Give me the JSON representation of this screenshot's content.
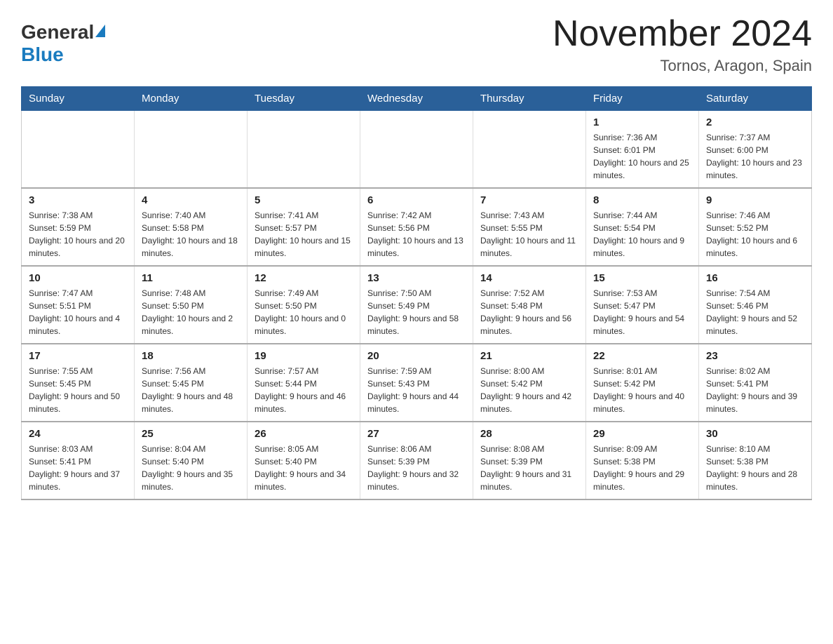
{
  "header": {
    "title": "November 2024",
    "location": "Tornos, Aragon, Spain",
    "logo_general": "General",
    "logo_blue": "Blue"
  },
  "days_of_week": [
    "Sunday",
    "Monday",
    "Tuesday",
    "Wednesday",
    "Thursday",
    "Friday",
    "Saturday"
  ],
  "weeks": [
    [
      {
        "day": "",
        "info": ""
      },
      {
        "day": "",
        "info": ""
      },
      {
        "day": "",
        "info": ""
      },
      {
        "day": "",
        "info": ""
      },
      {
        "day": "",
        "info": ""
      },
      {
        "day": "1",
        "info": "Sunrise: 7:36 AM\nSunset: 6:01 PM\nDaylight: 10 hours and 25 minutes."
      },
      {
        "day": "2",
        "info": "Sunrise: 7:37 AM\nSunset: 6:00 PM\nDaylight: 10 hours and 23 minutes."
      }
    ],
    [
      {
        "day": "3",
        "info": "Sunrise: 7:38 AM\nSunset: 5:59 PM\nDaylight: 10 hours and 20 minutes."
      },
      {
        "day": "4",
        "info": "Sunrise: 7:40 AM\nSunset: 5:58 PM\nDaylight: 10 hours and 18 minutes."
      },
      {
        "day": "5",
        "info": "Sunrise: 7:41 AM\nSunset: 5:57 PM\nDaylight: 10 hours and 15 minutes."
      },
      {
        "day": "6",
        "info": "Sunrise: 7:42 AM\nSunset: 5:56 PM\nDaylight: 10 hours and 13 minutes."
      },
      {
        "day": "7",
        "info": "Sunrise: 7:43 AM\nSunset: 5:55 PM\nDaylight: 10 hours and 11 minutes."
      },
      {
        "day": "8",
        "info": "Sunrise: 7:44 AM\nSunset: 5:54 PM\nDaylight: 10 hours and 9 minutes."
      },
      {
        "day": "9",
        "info": "Sunrise: 7:46 AM\nSunset: 5:52 PM\nDaylight: 10 hours and 6 minutes."
      }
    ],
    [
      {
        "day": "10",
        "info": "Sunrise: 7:47 AM\nSunset: 5:51 PM\nDaylight: 10 hours and 4 minutes."
      },
      {
        "day": "11",
        "info": "Sunrise: 7:48 AM\nSunset: 5:50 PM\nDaylight: 10 hours and 2 minutes."
      },
      {
        "day": "12",
        "info": "Sunrise: 7:49 AM\nSunset: 5:50 PM\nDaylight: 10 hours and 0 minutes."
      },
      {
        "day": "13",
        "info": "Sunrise: 7:50 AM\nSunset: 5:49 PM\nDaylight: 9 hours and 58 minutes."
      },
      {
        "day": "14",
        "info": "Sunrise: 7:52 AM\nSunset: 5:48 PM\nDaylight: 9 hours and 56 minutes."
      },
      {
        "day": "15",
        "info": "Sunrise: 7:53 AM\nSunset: 5:47 PM\nDaylight: 9 hours and 54 minutes."
      },
      {
        "day": "16",
        "info": "Sunrise: 7:54 AM\nSunset: 5:46 PM\nDaylight: 9 hours and 52 minutes."
      }
    ],
    [
      {
        "day": "17",
        "info": "Sunrise: 7:55 AM\nSunset: 5:45 PM\nDaylight: 9 hours and 50 minutes."
      },
      {
        "day": "18",
        "info": "Sunrise: 7:56 AM\nSunset: 5:45 PM\nDaylight: 9 hours and 48 minutes."
      },
      {
        "day": "19",
        "info": "Sunrise: 7:57 AM\nSunset: 5:44 PM\nDaylight: 9 hours and 46 minutes."
      },
      {
        "day": "20",
        "info": "Sunrise: 7:59 AM\nSunset: 5:43 PM\nDaylight: 9 hours and 44 minutes."
      },
      {
        "day": "21",
        "info": "Sunrise: 8:00 AM\nSunset: 5:42 PM\nDaylight: 9 hours and 42 minutes."
      },
      {
        "day": "22",
        "info": "Sunrise: 8:01 AM\nSunset: 5:42 PM\nDaylight: 9 hours and 40 minutes."
      },
      {
        "day": "23",
        "info": "Sunrise: 8:02 AM\nSunset: 5:41 PM\nDaylight: 9 hours and 39 minutes."
      }
    ],
    [
      {
        "day": "24",
        "info": "Sunrise: 8:03 AM\nSunset: 5:41 PM\nDaylight: 9 hours and 37 minutes."
      },
      {
        "day": "25",
        "info": "Sunrise: 8:04 AM\nSunset: 5:40 PM\nDaylight: 9 hours and 35 minutes."
      },
      {
        "day": "26",
        "info": "Sunrise: 8:05 AM\nSunset: 5:40 PM\nDaylight: 9 hours and 34 minutes."
      },
      {
        "day": "27",
        "info": "Sunrise: 8:06 AM\nSunset: 5:39 PM\nDaylight: 9 hours and 32 minutes."
      },
      {
        "day": "28",
        "info": "Sunrise: 8:08 AM\nSunset: 5:39 PM\nDaylight: 9 hours and 31 minutes."
      },
      {
        "day": "29",
        "info": "Sunrise: 8:09 AM\nSunset: 5:38 PM\nDaylight: 9 hours and 29 minutes."
      },
      {
        "day": "30",
        "info": "Sunrise: 8:10 AM\nSunset: 5:38 PM\nDaylight: 9 hours and 28 minutes."
      }
    ]
  ]
}
